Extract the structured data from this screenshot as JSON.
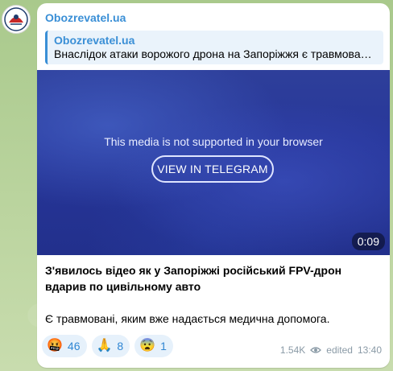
{
  "channel": {
    "name": "Obozrevatel.ua",
    "avatar_icon": "obozrevatel-logo"
  },
  "reply": {
    "name": "Obozrevatel.ua",
    "text": "Внаслідок атаки ворожого дрона на Запоріжжя є травмова…"
  },
  "media": {
    "message": "This media is not supported in your browser",
    "button_label": "VIEW IN TELEGRAM",
    "duration": "0:09"
  },
  "caption": {
    "headline": "З'явилось відео як у Запоріжжі російський FPV-дрон вдарив по цивільному авто",
    "body": "Є травмовані, яким вже надається медична допомога."
  },
  "reactions": [
    {
      "emoji": "🤬",
      "count": "46"
    },
    {
      "emoji": "🙏",
      "count": "8"
    },
    {
      "emoji": "😨",
      "count": "1"
    }
  ],
  "meta": {
    "views": "1.54K",
    "edited_label": "edited",
    "time": "13:40"
  },
  "colors": {
    "accent": "#3a8fd6",
    "reaction_bg": "#e6f1fb"
  }
}
